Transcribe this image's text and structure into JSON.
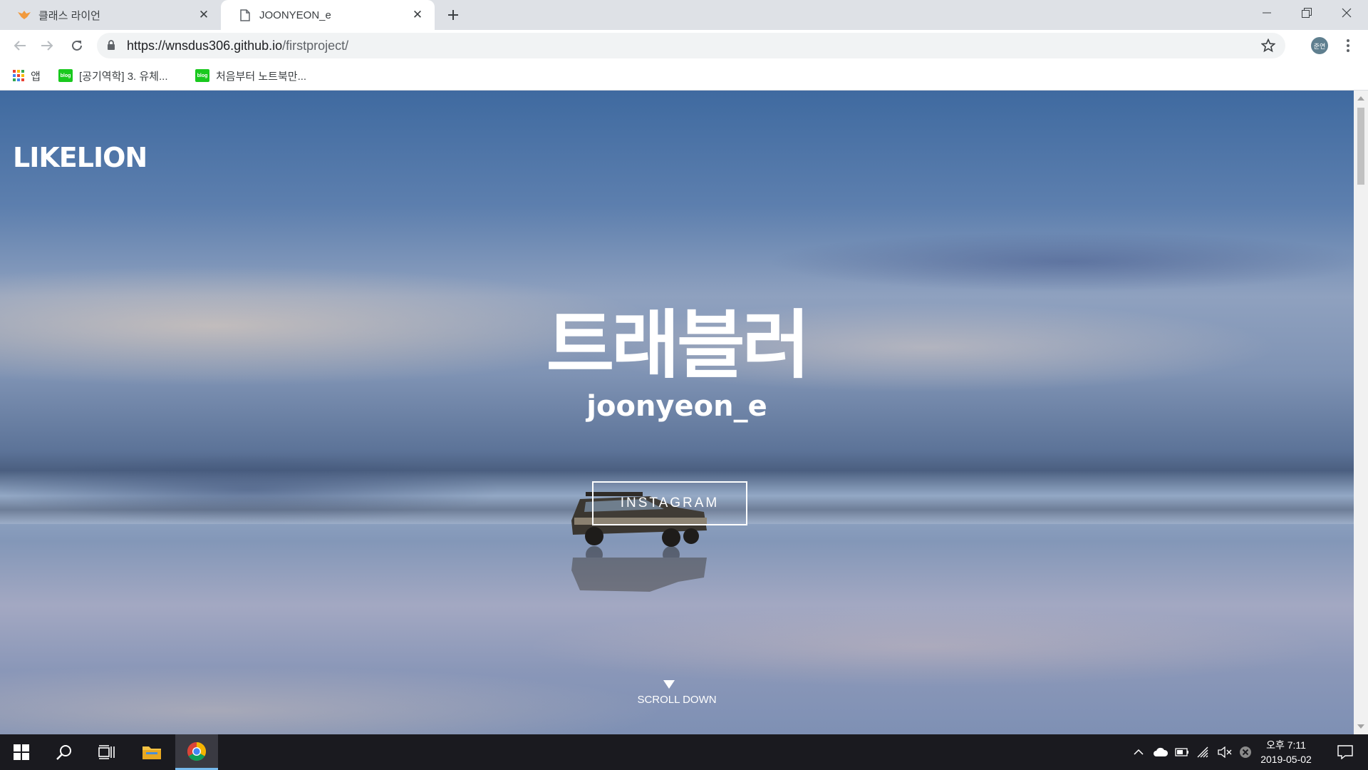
{
  "browser": {
    "tabs": [
      {
        "title": "클래스 라이언",
        "active": false
      },
      {
        "title": "JOONYEON_e",
        "active": true
      }
    ],
    "url": {
      "host": "https://wnsdus306.github.io",
      "path": "/firstproject/"
    },
    "profile_initials": "준연",
    "bookmarks": [
      {
        "label": "앱",
        "icon": "apps-grid-icon"
      },
      {
        "label": "[공기역학] 3. 유체...",
        "icon": "blog-icon"
      },
      {
        "label": "처음부터 노트북만...",
        "icon": "blog-icon"
      }
    ],
    "blog_icon_text": "blog"
  },
  "page": {
    "logo": "LIKELION",
    "title": "트래블러",
    "subtitle": "joonyeon_e",
    "button": "INSTAGRAM",
    "scroll_text": "SCROLL DOWN"
  },
  "taskbar": {
    "clock_time": "오후 7:11",
    "clock_date": "2019-05-02"
  },
  "colors": {
    "tab_strip": "#dee1e6",
    "taskbar": "#1a1a1f",
    "hero_text": "#ffffff",
    "taskbar_accent": "#76b9ed"
  }
}
